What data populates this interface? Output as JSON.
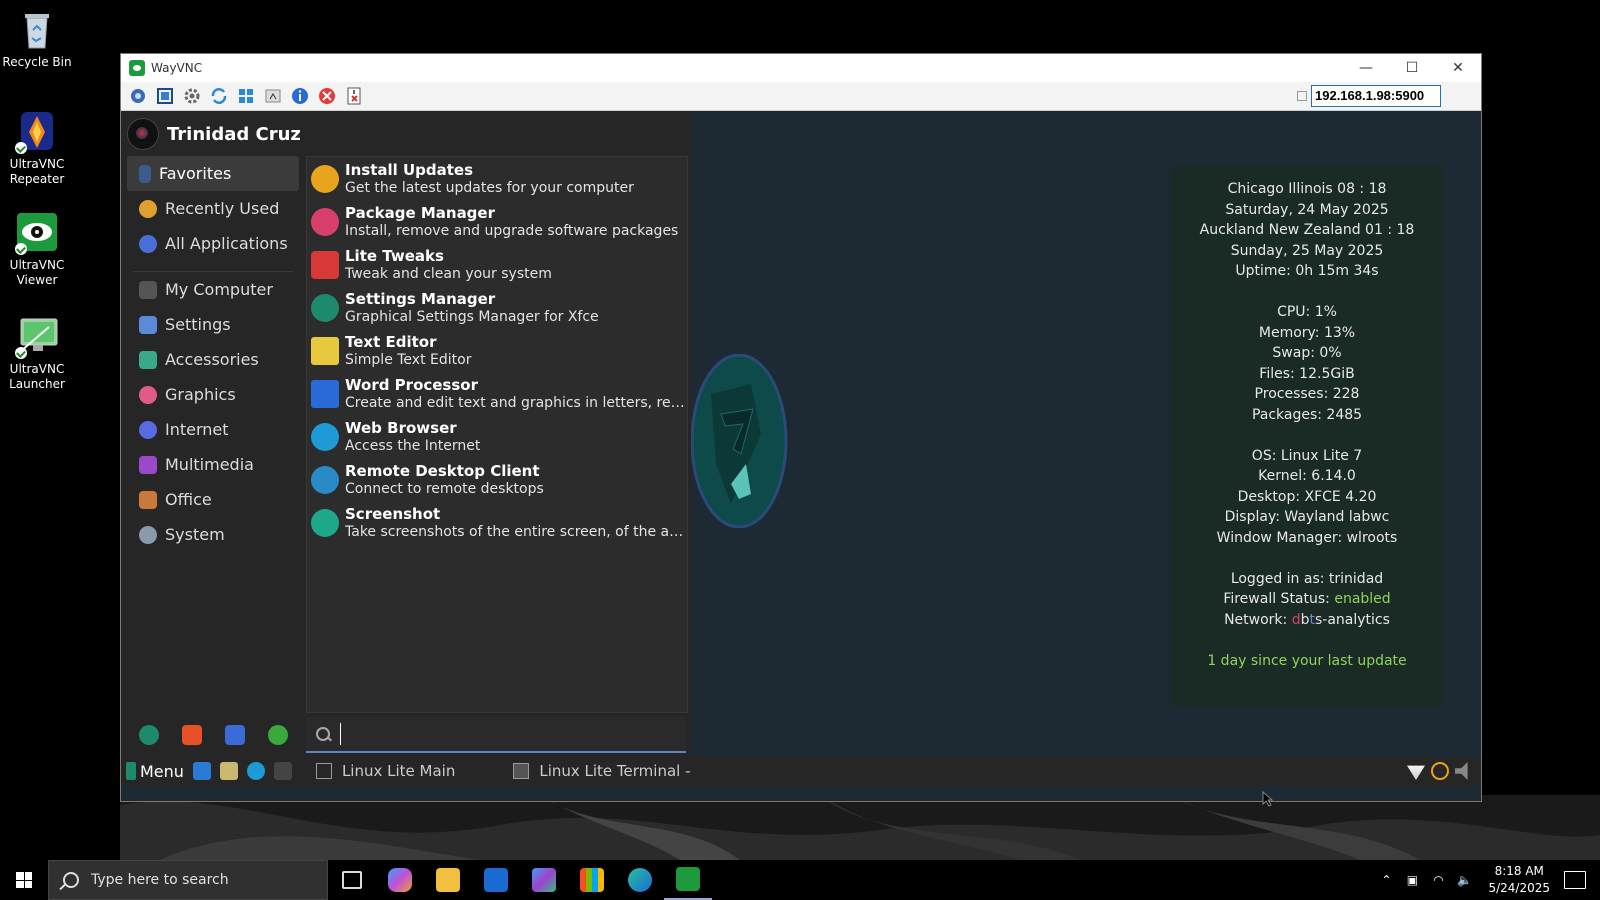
{
  "desktop": {
    "icons": [
      {
        "label": "Recycle Bin",
        "icon": "recycle-bin-icon"
      },
      {
        "label": "UltraVNC Repeater",
        "icon": "ultravnc-repeater-icon"
      },
      {
        "label": "UltraVNC Viewer",
        "icon": "ultravnc-viewer-icon"
      },
      {
        "label": "UltraVNC Launcher",
        "icon": "ultravnc-launcher-icon"
      }
    ]
  },
  "window": {
    "title": "WayVNC",
    "address": "192.168.1.98:5900",
    "controls": {
      "minimize": "—",
      "maximize": "☐",
      "close": "✕"
    }
  },
  "menu": {
    "user_name": "Trinidad Cruz",
    "categories": [
      {
        "label": "Favorites",
        "color": "#3c5a8a"
      },
      {
        "label": "Recently Used",
        "color": "#e0a030"
      },
      {
        "label": "All Applications",
        "color": "#4a6fd8"
      },
      {
        "label": "My Computer",
        "color": "#555555"
      },
      {
        "label": "Settings",
        "color": "#5a8ad8"
      },
      {
        "label": "Accessories",
        "color": "#3aa88a"
      },
      {
        "label": "Graphics",
        "color": "#e05a8a"
      },
      {
        "label": "Internet",
        "color": "#5a6ae0"
      },
      {
        "label": "Multimedia",
        "color": "#9a4ac8"
      },
      {
        "label": "Office",
        "color": "#c8783a"
      },
      {
        "label": "System",
        "color": "#8a9aaa"
      }
    ],
    "apps": [
      {
        "name": "Install Updates",
        "desc": "Get the latest updates for your computer",
        "color": "#e8a41c"
      },
      {
        "name": "Package Manager",
        "desc": "Install, remove and upgrade software packages",
        "color": "#d8406a"
      },
      {
        "name": "Lite Tweaks",
        "desc": "Tweak and clean your system",
        "color": "#d83838"
      },
      {
        "name": "Settings Manager",
        "desc": "Graphical Settings Manager for Xfce",
        "color": "#1e8a6d"
      },
      {
        "name": "Text Editor",
        "desc": "Simple Text Editor",
        "color": "#e8c83c"
      },
      {
        "name": "Word Processor",
        "desc": "Create and edit text and graphics in letters, repo…",
        "color": "#2a6ad8"
      },
      {
        "name": "Web Browser",
        "desc": "Access the Internet",
        "color": "#1e9ad8"
      },
      {
        "name": "Remote Desktop Client",
        "desc": "Connect to remote desktops",
        "color": "#2a8ac8"
      },
      {
        "name": "Screenshot",
        "desc": "Take screenshots of the entire screen, of the act…",
        "color": "#1ea88a"
      }
    ],
    "quick_actions": [
      {
        "icon": "settings-manager-icon",
        "color": "#1e8a6d"
      },
      {
        "icon": "lock-icon",
        "color": "#e8502a"
      },
      {
        "icon": "switch-user-icon",
        "color": "#3a6ad8"
      },
      {
        "icon": "logout-icon",
        "color": "#3aa83a"
      }
    ],
    "search_placeholder": ""
  },
  "sysinfo": {
    "group1": [
      "Chicago Illinois 08 : 18",
      "Saturday, 24 May 2025",
      "Auckland New Zealand  01 : 18",
      "Sunday, 25 May 2025",
      "Uptime: 0h 15m 34s"
    ],
    "group2": [
      "CPU: 1%",
      "Memory: 13%",
      "Swap: 0%",
      "Files: 12.5GiB",
      "Processes: 228",
      "Packages: 2485"
    ],
    "group3": [
      "OS: Linux Lite 7",
      "Kernel: 6.14.0",
      "Desktop: XFCE 4.20",
      "Display: Wayland labwc",
      "Window Manager: wlroots"
    ],
    "logged_in": "Logged in as: trinidad",
    "firewall_label": "Firewall Status: ",
    "firewall_value": "enabled",
    "network_label": "Network: ",
    "network_d": "d",
    "network_b": "b",
    "network_t": "t",
    "network_s": "s",
    "network_rest": "-analytics",
    "last_update": "1 day since your last update"
  },
  "remote_taskbar": {
    "menu_label": "Menu",
    "tasks": [
      "Linux Lite Main",
      "Linux Lite Terminal -"
    ]
  },
  "host_taskbar": {
    "search_placeholder": "Type here to search",
    "time": "8:18 AM",
    "date": "5/24/2025"
  }
}
